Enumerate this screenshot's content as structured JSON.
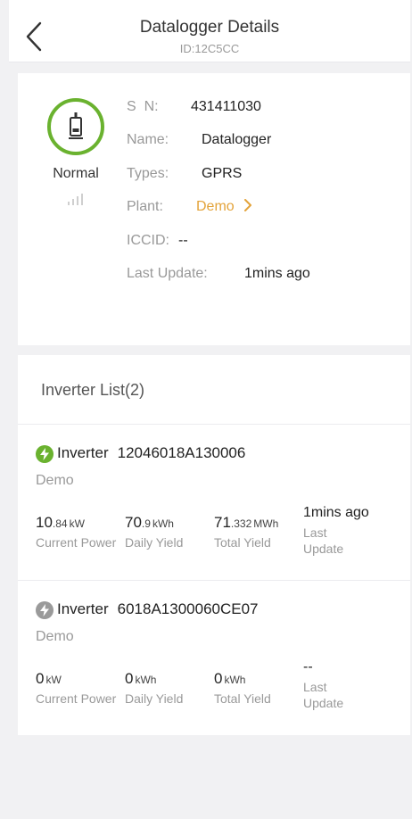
{
  "header": {
    "title": "Datalogger Details",
    "subtitle": "ID:12C5CC"
  },
  "info": {
    "status": "Normal",
    "sn_label": "S  N:",
    "sn_value": "431411030",
    "name_label": "Name:",
    "name_value": "Datalogger",
    "types_label": "Types:",
    "types_value": "GPRS",
    "plant_label": "Plant:",
    "plant_value": "Demo",
    "iccid_label": "ICCID:",
    "iccid_value": "--",
    "last_update_label": "Last Update:",
    "last_update_value": "1mins ago"
  },
  "inverter_list": {
    "title": "Inverter List(2)",
    "items": [
      {
        "type": "Inverter",
        "sn": "12046018A130006",
        "plant": "Demo",
        "icon_color": "#6ab22f",
        "power_int": "10",
        "power_dec": ".84",
        "power_unit": "kW",
        "power_label": "Current Power",
        "daily_int": "70",
        "daily_dec": ".9",
        "daily_unit": "kWh",
        "daily_label": "Daily Yield",
        "total_int": "71",
        "total_dec": ".332",
        "total_unit": "MWh",
        "total_label": "Total Yield",
        "last_update": "1mins ago",
        "last_update_label": "Last Update"
      },
      {
        "type": "Inverter",
        "sn": "6018A1300060CE07",
        "plant": "Demo",
        "icon_color": "#9a9a9a",
        "power_int": "0",
        "power_dec": "",
        "power_unit": "kW",
        "power_label": "Current Power",
        "daily_int": "0",
        "daily_dec": "",
        "daily_unit": "kWh",
        "daily_label": "Daily Yield",
        "total_int": "0",
        "total_dec": "",
        "total_unit": "kWh",
        "total_label": "Total Yield",
        "last_update": "--",
        "last_update_label": "Last Update"
      }
    ]
  },
  "colors": {
    "status_ok": "#6ab22f",
    "link": "#e3a33a",
    "offline": "#9a9a9a"
  }
}
